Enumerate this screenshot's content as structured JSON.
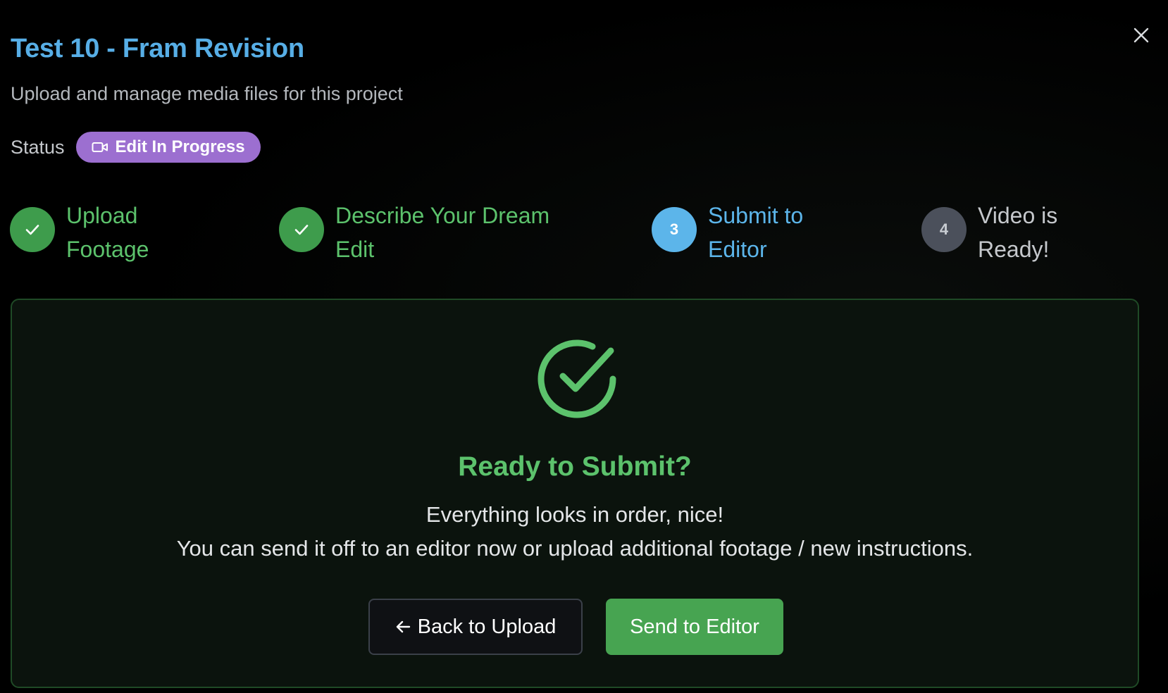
{
  "header": {
    "title": "Test 10 - Fram Revision",
    "subtitle": "Upload and manage media files for this project",
    "close_icon": "close-icon"
  },
  "status": {
    "label": "Status",
    "badge_text": "Edit In Progress",
    "badge_icon": "video-camera-icon",
    "badge_color": "#9c6fd0"
  },
  "steps": [
    {
      "state": "done",
      "marker": "",
      "line1": "Upload",
      "line2": "Footage"
    },
    {
      "state": "done",
      "marker": "",
      "line1": "Describe Your Dream",
      "line2": "Edit"
    },
    {
      "state": "current",
      "marker": "3",
      "line1": "Submit to",
      "line2": "Editor"
    },
    {
      "state": "todo",
      "marker": "4",
      "line1": "Video is",
      "line2": "Ready!"
    }
  ],
  "panel": {
    "icon": "check-circle-icon",
    "title": "Ready to Submit?",
    "line1": "Everything looks in order, nice!",
    "line2": "You can send it off to an editor now or upload additional footage / new instructions.",
    "back_label": "Back to Upload",
    "back_icon": "arrow-left-icon",
    "send_label": "Send to Editor"
  },
  "colors": {
    "accent_blue": "#57aee6",
    "success_green": "#5cc26c",
    "button_green": "#47a451",
    "step_todo_gray": "#4b505b"
  }
}
